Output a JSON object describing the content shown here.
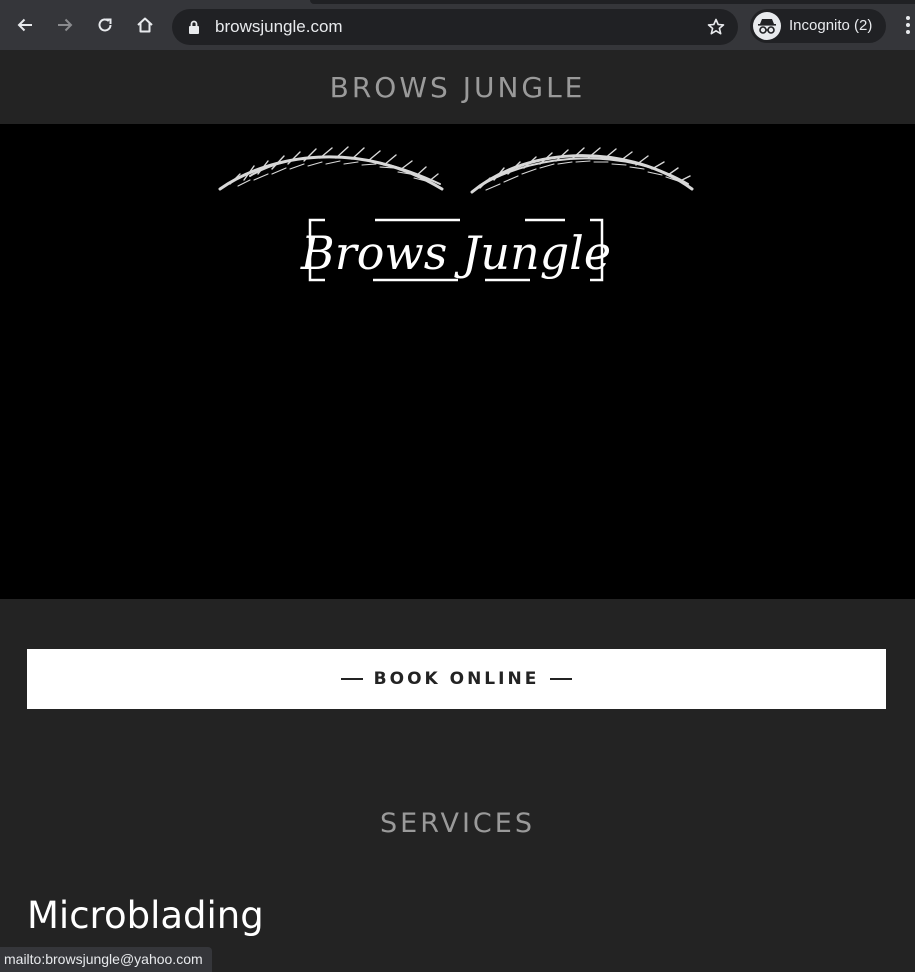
{
  "browser": {
    "url": "browsjungle.com",
    "profile_label": "Incognito (2)"
  },
  "site": {
    "title": "BROWS JUNGLE",
    "logo_text": "Brows Jungle"
  },
  "book": {
    "label": "BOOK ONLINE"
  },
  "services": {
    "heading": "SERVICES",
    "first_item": "Microblading"
  },
  "status_bar": {
    "text": "mailto:browsjungle@yahoo.com"
  },
  "colors": {
    "page_bg": "#232323",
    "hero_bg": "#000000",
    "chrome_bg": "#35363a",
    "button_bg": "#ffffff"
  }
}
